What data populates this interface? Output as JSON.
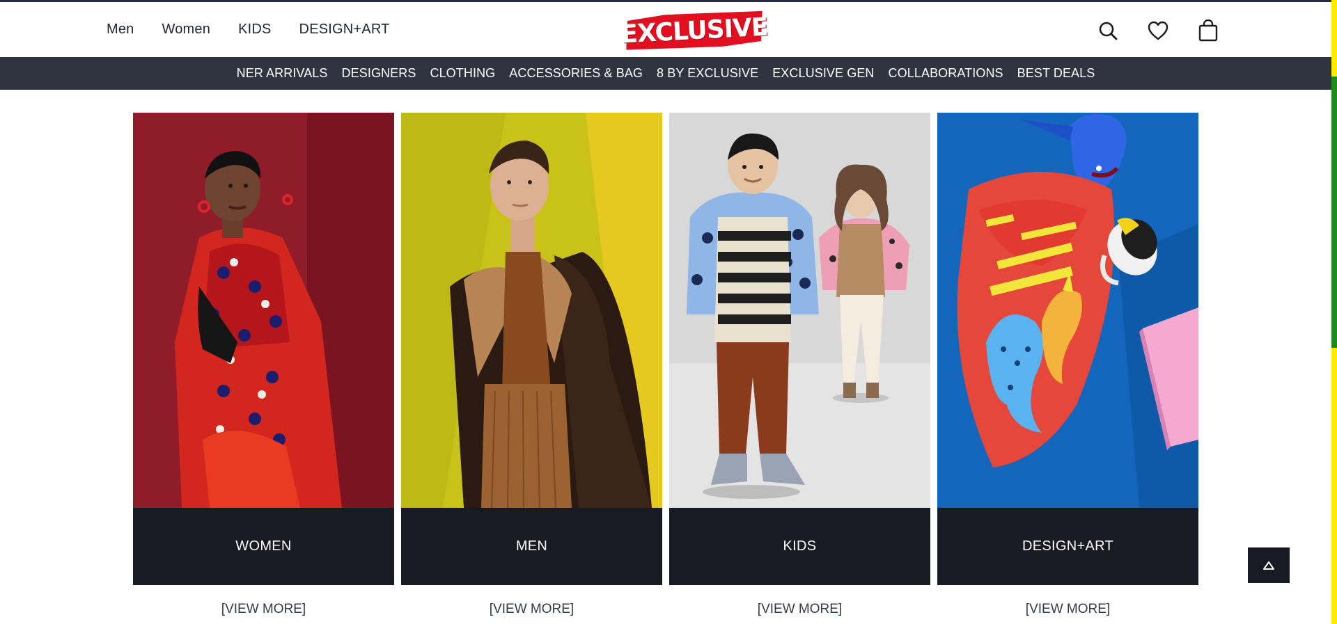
{
  "header": {
    "nav": [
      "Men",
      "Women",
      "KIDS",
      "DESIGN+ART"
    ],
    "logo_text": "EXCLUSIVE",
    "icons": [
      "search-icon",
      "heart-icon",
      "shopping-bag-icon"
    ]
  },
  "category_bar": {
    "items": [
      "NER ARRIVALS",
      "DESIGNERS",
      "CLOTHING",
      "ACCESSORIES & BAG",
      "8 BY EXCLUSIVE",
      "EXCLUSIVE GEN",
      "COLLABORATIONS",
      "BEST DEALS"
    ]
  },
  "tiles": [
    {
      "label": "WOMEN",
      "link": "[VIEW MORE]"
    },
    {
      "label": "MEN",
      "link": "[VIEW MORE]"
    },
    {
      "label": "KIDS",
      "link": "[VIEW MORE]"
    },
    {
      "label": "DESIGN+ART",
      "link": "[VIEW MORE]"
    }
  ],
  "colors": {
    "brand_red": "#e10f1f",
    "nav_bar": "#2f3440",
    "tile_caption": "#191b24"
  },
  "back_to_top_icon": "triangle-up-icon"
}
